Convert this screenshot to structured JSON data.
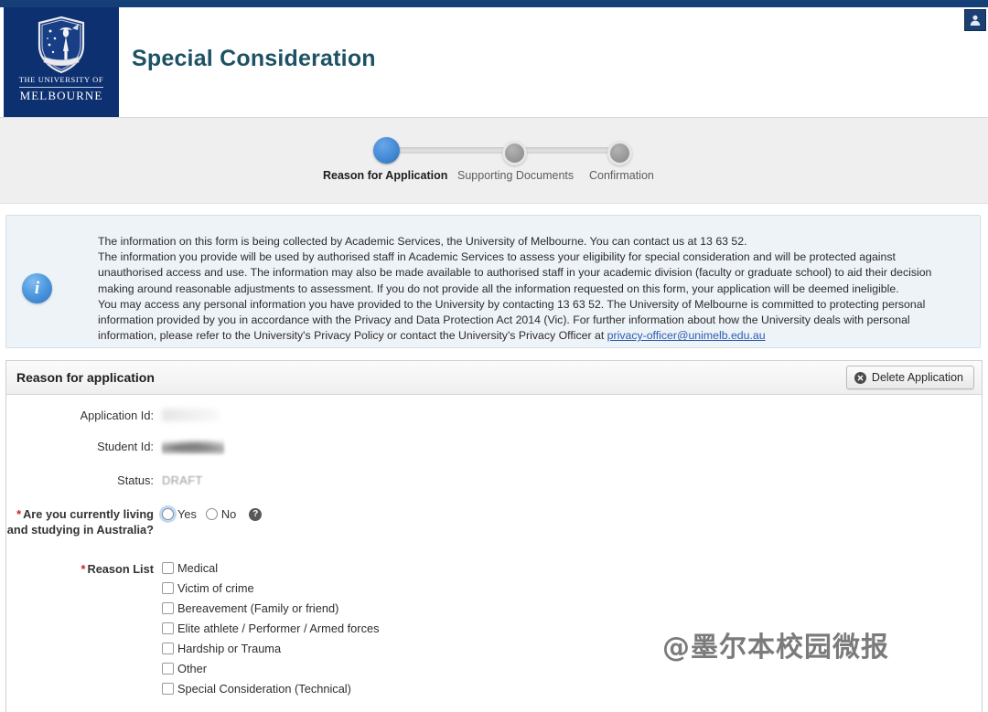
{
  "topbar": {
    "user_icon": "user-icon"
  },
  "header": {
    "logo_line1": "THE UNIVERSITY OF",
    "logo_line2": "MELBOURNE",
    "title": "Special Consideration"
  },
  "stepper": {
    "steps": [
      {
        "label": "Reason for Application",
        "state": "active"
      },
      {
        "label": "Supporting Documents",
        "state": "idle"
      },
      {
        "label": "Confirmation",
        "state": "idle"
      }
    ],
    "active_color": "#4a8fda",
    "idle_color": "#9b9b9b"
  },
  "info": {
    "icon": "info-icon",
    "lines": [
      "The information on this form is being collected by Academic Services, the University of Melbourne. You can contact us at 13 63 52.",
      "The information you provide will be used by authorised staff in Academic Services to assess your eligibility for special consideration and will be protected against",
      "unauthorised access and use. The information may also be made available to authorised staff in your academic division (faculty or graduate school) to aid their decision",
      "making around reasonable adjustments to assessment. If you do not provide all the information requested on this form, your application will be deemed ineligible.",
      "You may access any personal information you have provided to the University by contacting 13 63 52. The University of Melbourne is committed to protecting personal",
      "information provided by you in accordance with the Privacy and Data Protection Act 2014 (Vic). For further information about how the University deals with personal"
    ],
    "last_line_prefix": "information, please refer to the University's Privacy Policy or contact the University's Privacy Officer at ",
    "privacy_email": "privacy-officer@unimelb.edu.au",
    "link_color": "#2a5db0"
  },
  "form": {
    "panel_title": "Reason for application",
    "delete_button": "Delete Application",
    "delete_icon": "close-circle-icon",
    "fields": {
      "application_id_label": "Application Id:",
      "application_id_value": "",
      "student_id_label": "Student Id:",
      "student_id_value": "",
      "status_label": "Status:",
      "status_value": "DRAFT"
    },
    "australia_question": {
      "label": "Are you currently living and studying in Australia?",
      "required": true,
      "required_marker": "*",
      "option_yes": "Yes",
      "option_no": "No",
      "selected": "",
      "help_icon": "question-mark-icon"
    },
    "reason_list": {
      "label": "Reason List",
      "required": true,
      "required_marker": "*",
      "options": [
        {
          "label": "Medical",
          "checked": false
        },
        {
          "label": "Victim of crime",
          "checked": false
        },
        {
          "label": "Bereavement (Family or friend)",
          "checked": false
        },
        {
          "label": "Elite athlete / Performer / Armed forces",
          "checked": false
        },
        {
          "label": "Hardship or Trauma",
          "checked": false
        },
        {
          "label": "Other",
          "checked": false
        },
        {
          "label": "Special Consideration (Technical)",
          "checked": false
        }
      ]
    }
  },
  "watermark": {
    "text": "@墨尔本校园微报"
  }
}
